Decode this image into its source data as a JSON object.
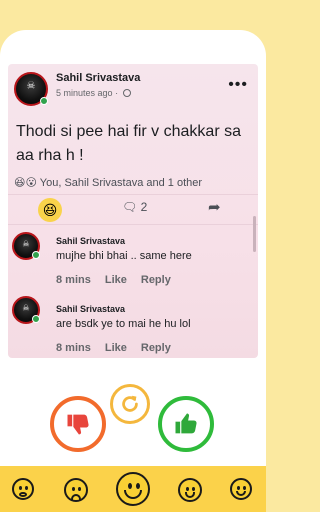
{
  "post": {
    "author": "Sahil Srivastava",
    "time": "5 minutes ago",
    "separator": "·",
    "text": "Thodi si pee hai fir v chakkar sa aa rha h !",
    "reactions_summary": "You, Sahil Srivastava and 1 other",
    "comment_count": "2",
    "more": "•••"
  },
  "comments": [
    {
      "author": "Sahil Srivastava",
      "text": "mujhe bhi bhai .. same here",
      "time": "8 mins",
      "like_label": "Like",
      "reply_label": "Reply"
    },
    {
      "author": "Sahil Srivastava",
      "text": "are bsdk ye to mai he hu lol",
      "time": "8 mins",
      "like_label": "Like",
      "reply_label": "Reply"
    }
  ],
  "colors": {
    "background": "#fbe9a0",
    "dislike_ring": "#f26b2c",
    "like_ring": "#2fbb3b",
    "refresh_ring": "#f4b73d",
    "bottom_bar": "#fbd24a"
  },
  "icons": [
    "dislike-icon",
    "refresh-icon",
    "like-icon",
    "emoji-icon"
  ]
}
